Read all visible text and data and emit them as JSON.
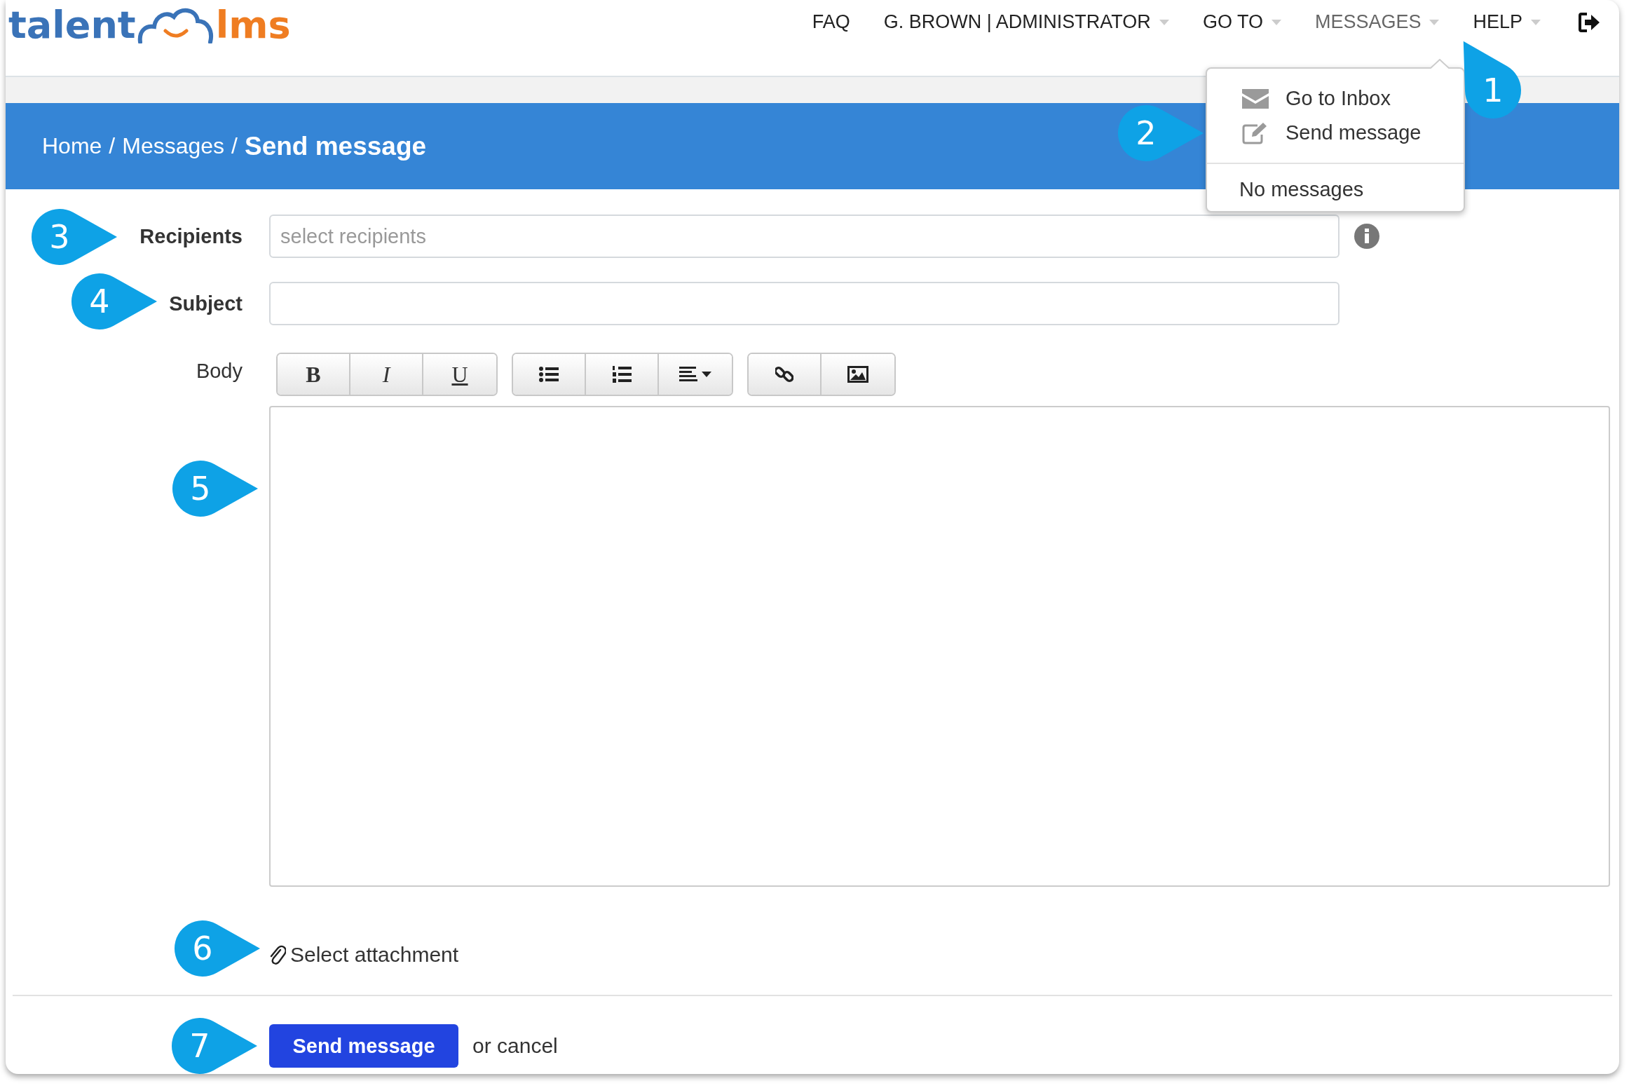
{
  "logo": {
    "parts": [
      "talent",
      "lms"
    ]
  },
  "nav": [
    {
      "label": "FAQ",
      "caret": false,
      "selected": false
    },
    {
      "label": "G. BROWN | ADMINISTRATOR",
      "caret": true,
      "selected": false
    },
    {
      "label": "GO TO",
      "caret": true,
      "selected": false
    },
    {
      "label": "MESSAGES",
      "caret": true,
      "selected": true
    },
    {
      "label": "HELP",
      "caret": true,
      "selected": false
    }
  ],
  "messages_menu": [
    {
      "kind": "mail",
      "label": "Go to Inbox"
    },
    {
      "kind": "compose",
      "label": "Send message"
    },
    {
      "kind": "divider"
    },
    {
      "kind": "note",
      "label": "No messages"
    }
  ],
  "breadcrumb": [
    {
      "kind": "link",
      "text": "Home"
    },
    {
      "kind": "separator",
      "text": "/"
    },
    {
      "kind": "link",
      "text": "Messages"
    },
    {
      "kind": "separator",
      "text": "/"
    },
    {
      "kind": "current",
      "text": "Send message"
    }
  ],
  "form": {
    "recipients": {
      "label": "Recipients",
      "placeholder": "select recipients"
    },
    "subject": {
      "label": "Subject"
    },
    "body": {
      "label": "Body"
    },
    "toolbar": [
      [
        {
          "kind": "bold",
          "text": "B"
        },
        {
          "kind": "italic",
          "text": "I"
        },
        {
          "kind": "underline",
          "text": "U"
        }
      ],
      [
        {
          "kind": "bullets"
        },
        {
          "kind": "numbers"
        },
        {
          "kind": "align"
        }
      ],
      [
        {
          "kind": "link"
        },
        {
          "kind": "image"
        }
      ]
    ],
    "attachment": "Select attachment",
    "submit": "Send message",
    "cancel": "or cancel"
  },
  "callouts": [
    "1",
    "2",
    "3",
    "4",
    "5",
    "6",
    "7"
  ]
}
